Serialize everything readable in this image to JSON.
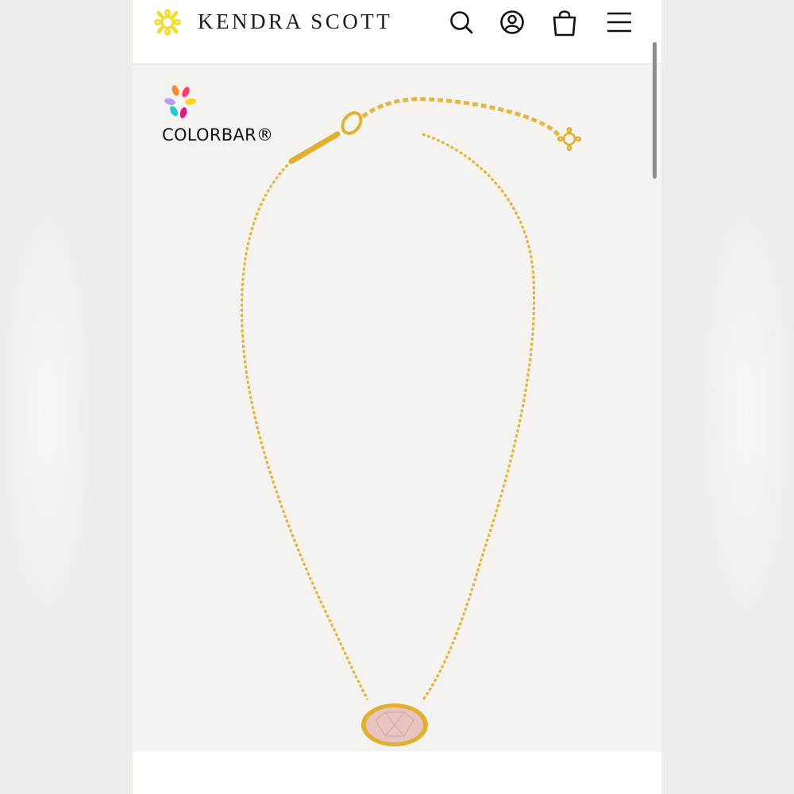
{
  "header": {
    "brand_name": "KENDRA SCOTT",
    "logo_icon": "kendra-scott-filigree-icon",
    "buttons": [
      {
        "name": "search",
        "icon": "search-icon"
      },
      {
        "name": "account",
        "icon": "account-icon"
      },
      {
        "name": "bag",
        "icon": "shopping-bag-icon"
      },
      {
        "name": "menu",
        "icon": "hamburger-menu-icon"
      }
    ]
  },
  "product": {
    "badge_label": "COLORBAR®",
    "badge_icon": "colorbar-petals-icon",
    "image_subject": "gold chain pendant necklace with oval pink stone",
    "stone_color": "#e8c4c0",
    "metal_color": "#e2b842"
  },
  "colors": {
    "brand_yellow": "#f2dc2c",
    "header_bg": "#ffffff",
    "page_bg": "#f5f3f0",
    "text_dark": "#1d1d1d"
  }
}
